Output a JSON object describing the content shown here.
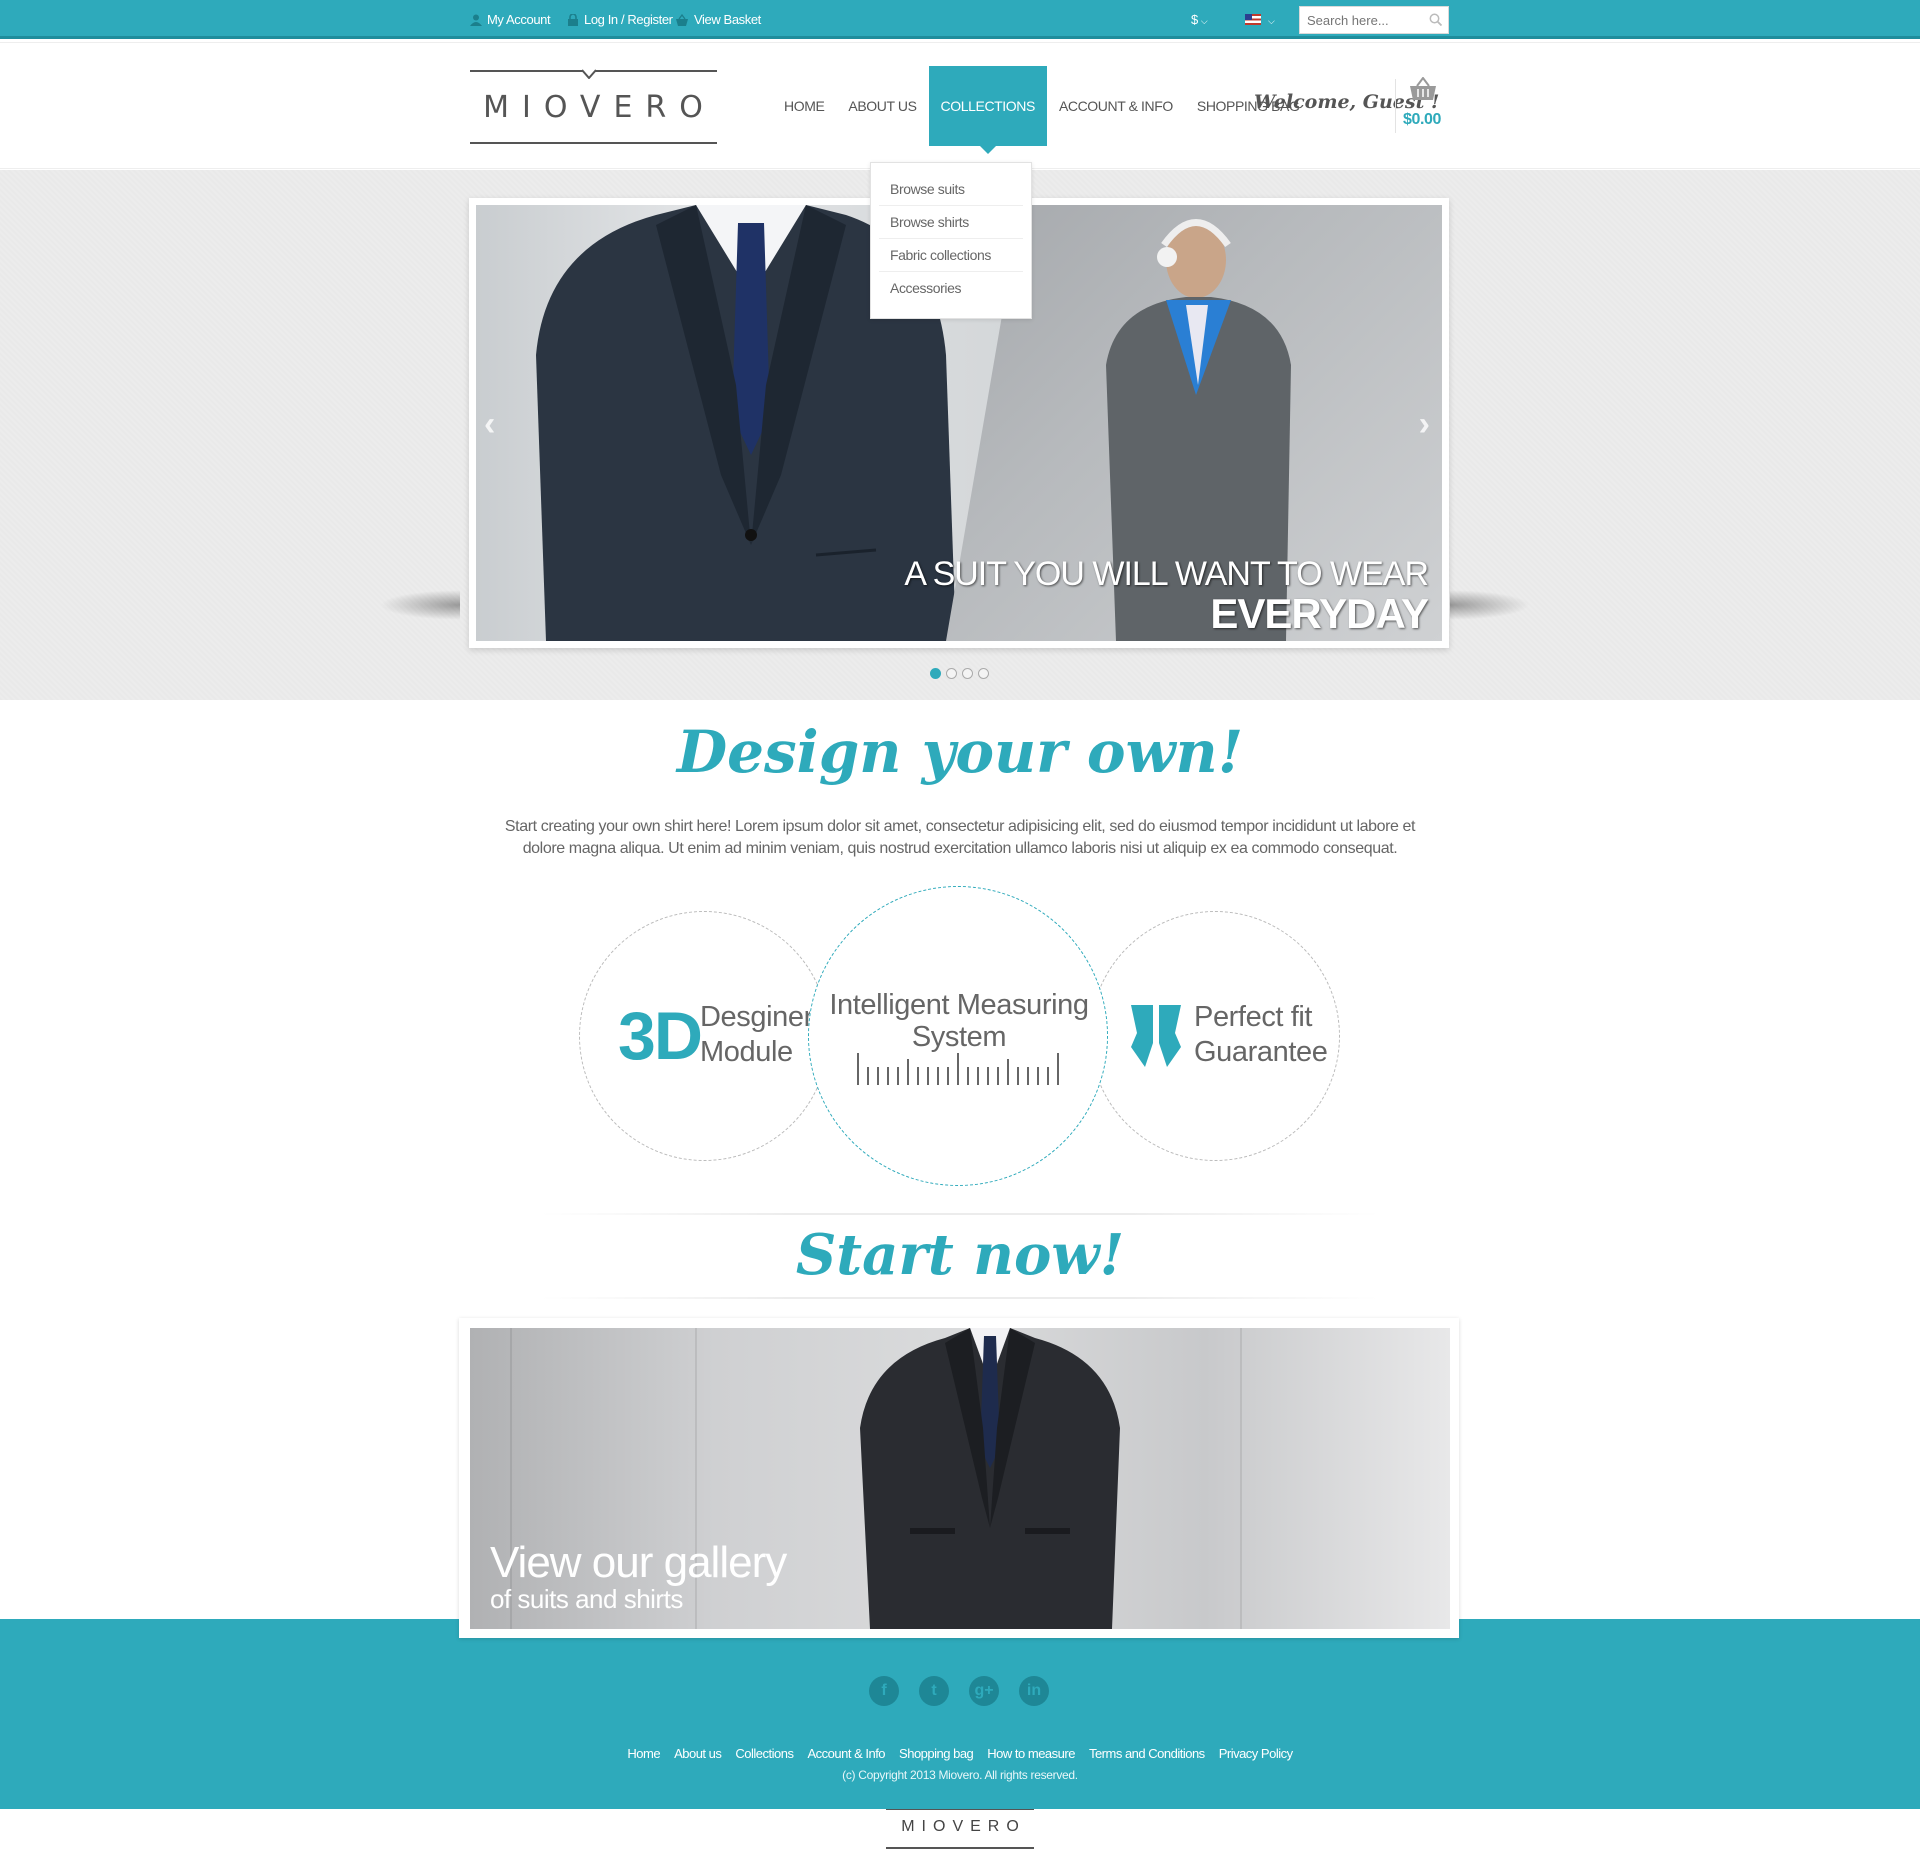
{
  "topbar": {
    "my_account": "My Account",
    "login": "Log In / Register",
    "view_basket": "View Basket",
    "currency": "$",
    "search_placeholder": "Search here..."
  },
  "header": {
    "logo": "MIOVERO",
    "nav": [
      "HOME",
      "ABOUT US",
      "COLLECTIONS",
      "ACCOUNT & INFO",
      "SHOPPING BAG"
    ],
    "active_nav": "COLLECTIONS",
    "welcome": "Welcome, Guest !",
    "cart_total": "$0.00"
  },
  "dropdown": [
    "Browse suits",
    "Browse shirts",
    "Fabric collections",
    "Accessories"
  ],
  "hero": {
    "caption_line1": "A SUIT YOU WILL WANT TO WEAR",
    "caption_line2": "EVERYDAY",
    "slides": 4,
    "active_slide": 1
  },
  "design": {
    "title": "Design your own!",
    "text": "Start creating your own shirt here! Lorem ipsum dolor sit amet, consectetur adipisicing elit, sed do eiusmod tempor incididunt ut labore et dolore magna aliqua. Ut enim ad minim veniam, quis nostrud exercitation ullamco laboris nisi ut aliquip ex ea commodo consequat.",
    "feature1_big": "3D",
    "feature1_l1": "Desginer",
    "feature1_l2": "Module",
    "feature2_l1": "Intelligent Measuring",
    "feature2_l2": "System",
    "feature3_l1": "Perfect fit",
    "feature3_l2": "Guarantee"
  },
  "start": {
    "title": "Start now!",
    "gallery_l1": "View our gallery",
    "gallery_l2": "of suits and shirts"
  },
  "footer": {
    "socials": [
      "f",
      "t",
      "g+",
      "in"
    ],
    "links": [
      "Home",
      "About us",
      "Collections",
      "Account & Info",
      "Shopping bag",
      "How to measure",
      "Terms and Conditions",
      "Privacy Policy"
    ],
    "copyright": "(c) Copyright 2013 Miovero. All rights reserved.",
    "logo": "MIOVERO"
  },
  "colors": {
    "accent": "#2eaabb",
    "accent_dark": "#1e8796"
  }
}
